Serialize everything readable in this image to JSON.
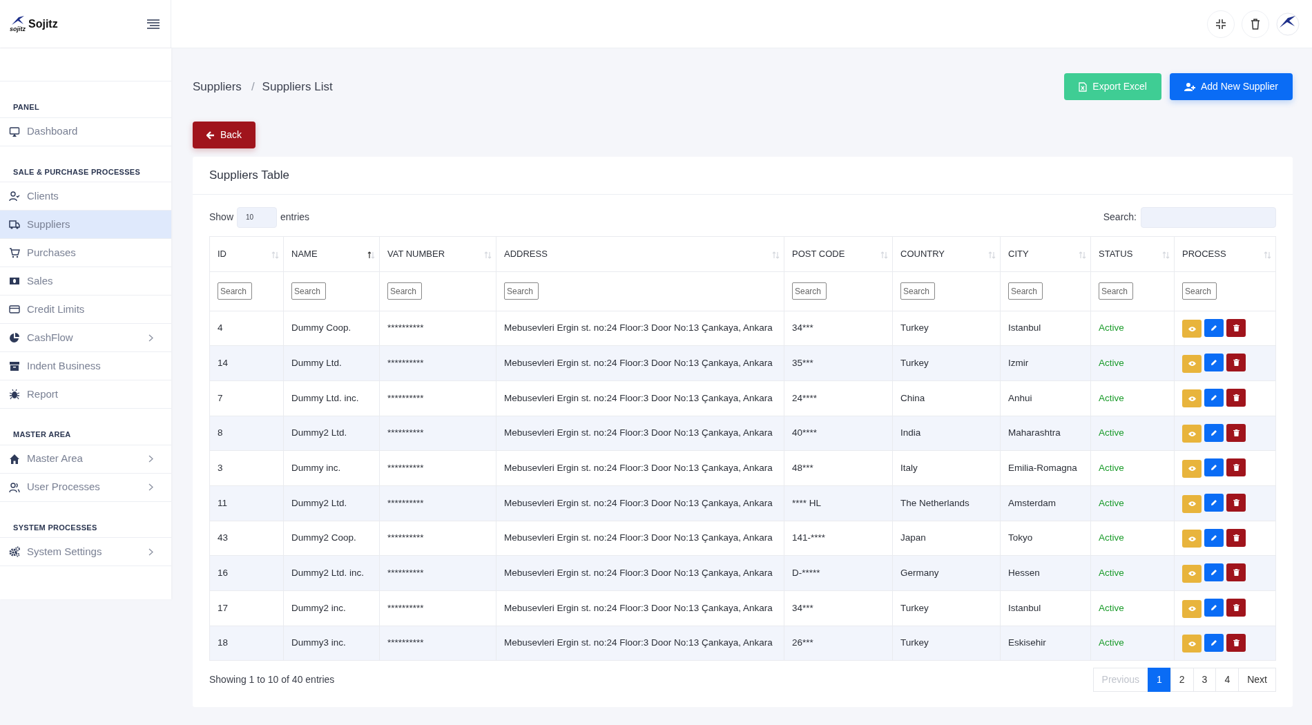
{
  "brand": {
    "name": "Sojitz",
    "mark_text": "sojitz"
  },
  "sidebar": {
    "sections": [
      {
        "title": "PANEL",
        "items": [
          {
            "label": "Dashboard",
            "selected": false,
            "expandable": false
          }
        ]
      },
      {
        "title": "SALE & PURCHASE PROCESSES",
        "items": [
          {
            "label": "Clients",
            "selected": false,
            "expandable": false
          },
          {
            "label": "Suppliers",
            "selected": true,
            "expandable": false
          },
          {
            "label": "Purchases",
            "selected": false,
            "expandable": false
          },
          {
            "label": "Sales",
            "selected": false,
            "expandable": false
          },
          {
            "label": "Credit Limits",
            "selected": false,
            "expandable": false
          },
          {
            "label": "CashFlow",
            "selected": false,
            "expandable": true
          },
          {
            "label": "Indent Business",
            "selected": false,
            "expandable": false
          },
          {
            "label": "Report",
            "selected": false,
            "expandable": false
          }
        ]
      },
      {
        "title": "MASTER AREA",
        "items": [
          {
            "label": "Master Area",
            "selected": false,
            "expandable": true
          },
          {
            "label": "User Processes",
            "selected": false,
            "expandable": true
          }
        ]
      },
      {
        "title": "SYSTEM PROCESSES",
        "items": [
          {
            "label": "System Settings",
            "selected": false,
            "expandable": true
          }
        ]
      }
    ]
  },
  "breadcrumb": [
    "Suppliers",
    "Suppliers List"
  ],
  "breadcrumb_separator": "/",
  "actions": [
    {
      "label": "Export Excel",
      "kind": "export"
    },
    {
      "label": "Add New Supplier",
      "kind": "add"
    }
  ],
  "back_button": "Back",
  "card": {
    "title": "Suppliers Table",
    "length": {
      "before": "Show",
      "value": "10",
      "after": "entries"
    },
    "search_label": "Search:",
    "columns": [
      {
        "label": "ID",
        "sorted": false,
        "placeholder": "Search"
      },
      {
        "label": "NAME",
        "sorted": true,
        "placeholder": "Search"
      },
      {
        "label": "VAT NUMBER",
        "sorted": false,
        "placeholder": "Search"
      },
      {
        "label": "ADDRESS",
        "sorted": false,
        "placeholder": "Search"
      },
      {
        "label": "POST CODE",
        "sorted": false,
        "placeholder": "Search"
      },
      {
        "label": "COUNTRY",
        "sorted": false,
        "placeholder": "Search"
      },
      {
        "label": "CITY",
        "sorted": false,
        "placeholder": "Search"
      },
      {
        "label": "STATUS",
        "sorted": false,
        "placeholder": "Search"
      },
      {
        "label": "PROCESS",
        "sorted": false,
        "placeholder": "Search"
      }
    ],
    "rows": [
      {
        "id": "4",
        "name": "Dummy Coop.",
        "vat": "**********",
        "address": "Mebusevleri Ergin st. no:24 Floor:3 Door No:13 Çankaya, Ankara",
        "post_code": "34***",
        "country": "Turkey",
        "city": "Istanbul",
        "status": "Active",
        "active": true
      },
      {
        "id": "14",
        "name": "Dummy Ltd.",
        "vat": "**********",
        "address": "Mebusevleri Ergin st. no:24 Floor:3 Door No:13 Çankaya, Ankara",
        "post_code": "35***",
        "country": "Turkey",
        "city": "Izmir",
        "status": "Active",
        "active": true
      },
      {
        "id": "7",
        "name": "Dummy Ltd. inc.",
        "vat": "**********",
        "address": "Mebusevleri Ergin st. no:24 Floor:3 Door No:13 Çankaya, Ankara",
        "post_code": "24****",
        "country": "China",
        "city": "Anhui",
        "status": "Active",
        "active": true
      },
      {
        "id": "8",
        "name": "Dummy2 Ltd.",
        "vat": "**********",
        "address": "Mebusevleri Ergin st. no:24 Floor:3 Door No:13 Çankaya, Ankara",
        "post_code": "40****",
        "country": "India",
        "city": "Maharashtra",
        "status": "Active",
        "active": true
      },
      {
        "id": "3",
        "name": "Dummy inc.",
        "vat": "**********",
        "address": "Mebusevleri Ergin st. no:24 Floor:3 Door No:13 Çankaya, Ankara",
        "post_code": "48***",
        "country": "Italy",
        "city": "Emilia-Romagna",
        "status": "Active",
        "active": true
      },
      {
        "id": "11",
        "name": "Dummy2 Ltd.",
        "vat": "**********",
        "address": "Mebusevleri Ergin st. no:24 Floor:3 Door No:13 Çankaya, Ankara",
        "post_code": "**** HL",
        "country": "The Netherlands",
        "city": "Amsterdam",
        "status": "Active",
        "active": true
      },
      {
        "id": "43",
        "name": "Dummy2 Coop.",
        "vat": "**********",
        "address": "Mebusevleri Ergin st. no:24 Floor:3 Door No:13 Çankaya, Ankara",
        "post_code": "141-****",
        "country": "Japan",
        "city": "Tokyo",
        "status": "Active",
        "active": true
      },
      {
        "id": "16",
        "name": "Dummy2 Ltd. inc.",
        "vat": "**********",
        "address": "Mebusevleri Ergin st. no:24 Floor:3 Door No:13 Çankaya, Ankara",
        "post_code": "D-*****",
        "country": "Germany",
        "city": "Hessen",
        "status": "Active",
        "active": true
      },
      {
        "id": "17",
        "name": "Dummy2 inc.",
        "vat": "**********",
        "address": "Mebusevleri Ergin st. no:24 Floor:3 Door No:13 Çankaya, Ankara",
        "post_code": "34***",
        "country": "Turkey",
        "city": "Istanbul",
        "status": "Active",
        "active": true
      },
      {
        "id": "18",
        "name": "Dummy3 inc.",
        "vat": "**********",
        "address": "Mebusevleri Ergin st. no:24 Floor:3 Door No:13 Çankaya, Ankara",
        "post_code": "26***",
        "country": "Turkey",
        "city": "Eskisehir",
        "status": "Active",
        "active": true
      }
    ],
    "info": "Showing 1 to 10 of 40 entries",
    "pagination": [
      {
        "label": "Previous",
        "selected": false,
        "disabled": true
      },
      {
        "label": "1",
        "selected": true,
        "disabled": false
      },
      {
        "label": "2",
        "selected": false,
        "disabled": false
      },
      {
        "label": "3",
        "selected": false,
        "disabled": false
      },
      {
        "label": "4",
        "selected": false,
        "disabled": false
      },
      {
        "label": "Next",
        "selected": false,
        "disabled": false
      }
    ]
  }
}
